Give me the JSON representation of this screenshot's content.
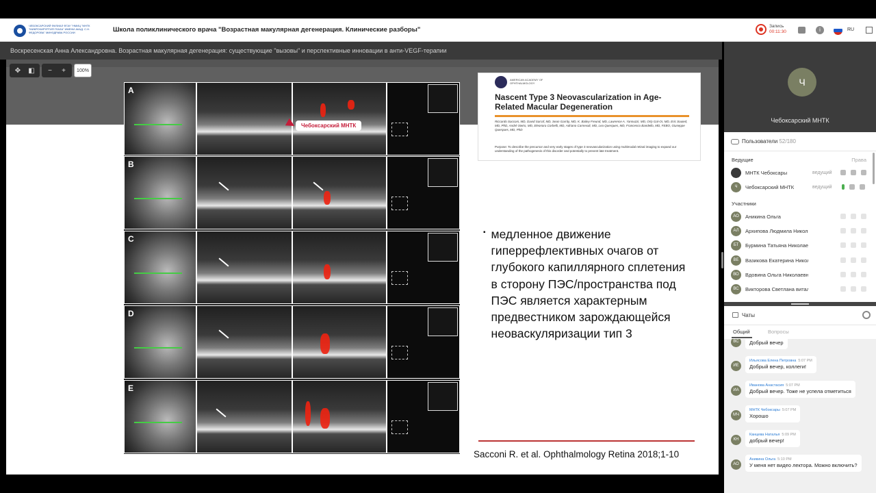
{
  "header": {
    "logo_text": "ЧЕБОКСАРСКИЙ ФИЛИАЛ ФГАУ \"НМИЦ \"МНТК \"МИКРОХИРУРГИЯ ГЛАЗА\" ИМЕНИ АКАД. С.Н. ФЕДОРОВА\" МИНЗДРАВА РОССИИ",
    "webinar_title": "Школа поликлинического врача \"Возрастная макулярная дегенерация. Клинические разборы\"",
    "record_label": "Запись",
    "record_time": "00:11:30",
    "info_glyph": "i",
    "language": "RU",
    "flag_colors": [
      "#ffffff",
      "#1c57c9",
      "#d52b1e"
    ]
  },
  "presentation": {
    "subtitle": "Воскресенская Анна Александровна. Возрастная макулярная дегенерация: существующие \"вызовы\" и перспективные инновации в анти-VEGF-терапии",
    "zoom": {
      "move": "✥",
      "fit": "◧",
      "minus": "−",
      "plus": "+",
      "value": "100%"
    },
    "pointer_label": "Чебоксарский МНТК",
    "figure_rows": [
      "A",
      "B",
      "C",
      "D",
      "E"
    ],
    "paper": {
      "org": "AMERICAN ACADEMY OF OPHTHALMOLOGY",
      "title": "Nascent Type 3 Neovascularization in Age-Related Macular Degeneration",
      "authors": "Riccardo Sacconi, MD, David Sarraf, MD, Sean Garrity, MD, K. Bailey Freund, MD, Lawrence A. Yannuzzi, MD, Orly Gal-Or, MD, Eric Souied, MD, PhD, André Sieiro, MD, Eleonora Corbelli, MD, Adriano Carnevali, MD, Lea Querques, MD, Francesco Bandello, MD, FEBO, Giuseppe Querques, MD, PhD",
      "purpose": "Purpose: To describe the precursor and very early stages of type 3 neovascularization using multimodal retinal imaging to expand our understanding of the pathogenesis of this disorder and potentially to prevent late treatment."
    },
    "bullet_marker": "▪",
    "bullet_text": "медленное движение гиперрефлективных очагов от глубокого капиллярного сплетения в сторону ПЭС/пространства под ПЭС является характерным предвестником зарождающейся неоваскуляризации тип 3",
    "reference": "Sacconi R. et al. Ophthalmology Retina 2018;1-10"
  },
  "sidebar": {
    "video": {
      "initial": "Ч",
      "name": "Чебоксарский МНТК"
    },
    "users": {
      "label": "Пользователи",
      "count": "52/180",
      "hosts_group": "Ведущие",
      "rights_label": "Права",
      "hosts": [
        {
          "initials": "",
          "name": "МНТК Чебоксары",
          "role": "ведущий"
        },
        {
          "initials": "Ч",
          "name": "Чебоксарский МНТК",
          "role": "ведущий"
        }
      ],
      "participants_group": "Участники",
      "participants": [
        {
          "initials": "АО",
          "name": "Аникина Ольга"
        },
        {
          "initials": "АЛ",
          "name": "Архипова Людмила Николаевна"
        },
        {
          "initials": "БТ",
          "name": "Бурмина Татьяна Николаевна"
        },
        {
          "initials": "ВЕ",
          "name": "Вазикова Екатерина Николаевна"
        },
        {
          "initials": "ВО",
          "name": "Вдовина Ольга Николаевна"
        },
        {
          "initials": "ВС",
          "name": "Викторова Светлана витальевна"
        }
      ]
    },
    "chat": {
      "label": "Чаты",
      "tab_general": "Общий",
      "tab_questions": "Вопросы",
      "messages": [
        {
          "initials": "ВС",
          "author": "",
          "time": "",
          "text": "Добрый вечер"
        },
        {
          "initials": "ИЕ",
          "author": "Ильясова Елена Петровна",
          "time": "5:07 PM",
          "text": "Добрый вечер, коллеги!"
        },
        {
          "initials": "ИА",
          "author": "Иванова Анастасия",
          "time": "5:07 PM",
          "text": "Добрый вечер. Тоже не успела отметиться"
        },
        {
          "initials": "МЧ",
          "author": "МНТК Чебоксары",
          "time": "5:07 PM",
          "text": "Хорошо"
        },
        {
          "initials": "КН",
          "author": "Канцева Наталья",
          "time": "5:09 PM",
          "text": "добрый вечер!"
        },
        {
          "initials": "АО",
          "author": "Аникина Ольга",
          "time": "5:10 PM",
          "text": "У меня нет видео лектора. Можно включить?"
        }
      ]
    }
  }
}
